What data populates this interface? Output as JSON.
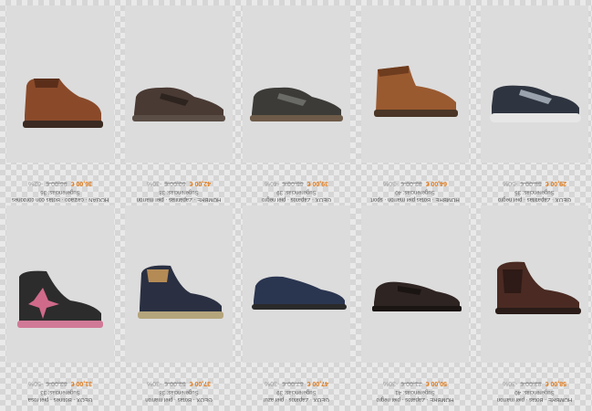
{
  "products": [
    {
      "name": "HOGAN · calzado · Botas con cordones",
      "sub": "Sugerencias: 36",
      "price": "36,00 €",
      "old": "96,00 €",
      "disc": "-62%",
      "shoe": "boot",
      "c1": "#8a4a2a",
      "c2": "#5b2e1a",
      "sole": "#3a2a22"
    },
    {
      "name": "HOMBRE · Zapatillas · piel marrón",
      "sub": "Sugerencias: 38",
      "price": "42,00 €",
      "old": "60,00 €",
      "disc": "-30%",
      "shoe": "sneaker",
      "c1": "#4a3a34",
      "c2": "#2e241f",
      "sole": "#5a4d45"
    },
    {
      "name": "GEOX · Zapatos · piel negro",
      "sub": "Sugerencias: 39",
      "price": "39,00 €",
      "old": "65,00 €",
      "disc": "-40%",
      "shoe": "sneaker",
      "c1": "#3c3b38",
      "c2": "#6a6a66",
      "sole": "#6d5a48"
    },
    {
      "name": "HOMBRE · Botas piel marrón · sport",
      "sub": "Sugerencias: 40",
      "price": "64,00 €",
      "old": "92,00 €",
      "disc": "-30%",
      "shoe": "boot2",
      "c1": "#9a5a30",
      "c2": "#6e3c1e",
      "sole": "#4a3526"
    },
    {
      "name": "GEOX · Zapatillas · piel negro",
      "sub": "Sugerencias: 35",
      "price": "29,00 €",
      "old": "58,00 €",
      "disc": "-50%",
      "shoe": "runner",
      "c1": "#2f3540",
      "c2": "#9aa3ad",
      "sole": "#e6e6e6"
    },
    {
      "name": "GEOX · Botines · piel rosa",
      "sub": "Sugerencias: 33",
      "price": "31,00 €",
      "old": "62,00 €",
      "disc": "-50%",
      "shoe": "hightop",
      "c1": "#2c2c2c",
      "c2": "#d06a8a",
      "sole": "#d07a98"
    },
    {
      "name": "GEOX · Botas · piel marrón",
      "sub": "Sugerencias: 38",
      "price": "37,00 €",
      "old": "53,00 €",
      "disc": "-30%",
      "shoe": "hightop2",
      "c1": "#2a3042",
      "c2": "#b58b55",
      "sole": "#b5a57c"
    },
    {
      "name": "GEOX · Zapatos · piel azul",
      "sub": "Sugerencias: 39",
      "price": "47,00 €",
      "old": "67,00 €",
      "disc": "-30%",
      "shoe": "lowboot",
      "c1": "#2a3550",
      "c2": "#1e263a",
      "sole": "#2a2a2a"
    },
    {
      "name": "HOMBRE · Zapatos · piel negro",
      "sub": "Sugerencias: 41",
      "price": "50,00 €",
      "old": "71,00 €",
      "disc": "-30%",
      "shoe": "dress",
      "c1": "#2e2422",
      "c2": "#1a1412",
      "sole": "#1a1412"
    },
    {
      "name": "HOMBRE · Botas · piel marrón",
      "sub": "Sugerencias: 40",
      "price": "58,00 €",
      "old": "83,00 €",
      "disc": "-30%",
      "shoe": "chelsea",
      "c1": "#4a2a22",
      "c2": "#2e1a16",
      "sole": "#2a1c18"
    }
  ]
}
